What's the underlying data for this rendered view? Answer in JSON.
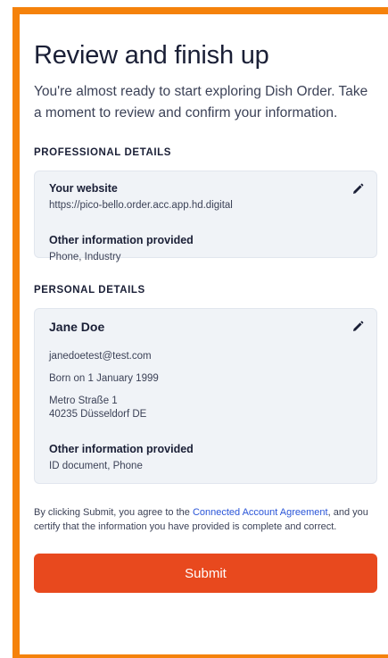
{
  "header": {
    "title": "Review and finish up",
    "subtitle": "You're almost ready to start exploring Dish Order. Take a moment to review and confirm your information."
  },
  "professional": {
    "section_label": "PROFESSIONAL DETAILS",
    "website_label": "Your website",
    "website_value": "https://pico-bello.order.acc.app.hd.digital",
    "other_label": "Other information provided",
    "other_value": "Phone, Industry"
  },
  "personal": {
    "section_label": "PERSONAL DETAILS",
    "name": "Jane Doe",
    "email": "janedoetest@test.com",
    "dob": "Born on 1 January 1999",
    "address_line1": "Metro Straße 1",
    "address_line2": "40235 Düsseldorf DE",
    "other_label": "Other information provided",
    "other_value": "ID document, Phone"
  },
  "footer": {
    "disclaimer_prefix": "By clicking Submit, you agree to the ",
    "agreement_link": "Connected Account Agreement",
    "disclaimer_suffix": ", and you certify that the information you have provided is complete and correct.",
    "submit_label": "Submit"
  },
  "icons": {
    "edit": "pencil-icon"
  },
  "colors": {
    "frame": "#f5820b",
    "button": "#e8491e",
    "link": "#2a55d8",
    "card_bg": "#f0f3f7"
  }
}
